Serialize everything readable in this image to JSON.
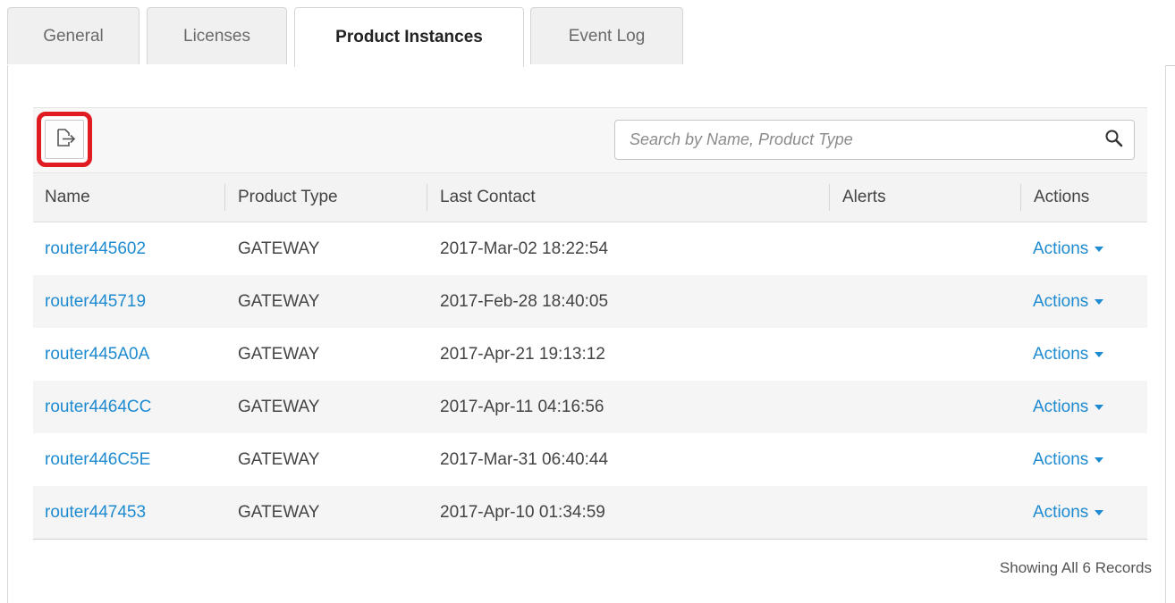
{
  "tabs": [
    {
      "label": "General",
      "active": false
    },
    {
      "label": "Licenses",
      "active": false
    },
    {
      "label": "Product Instances",
      "active": true
    },
    {
      "label": "Event Log",
      "active": false
    }
  ],
  "toolbar": {
    "export_icon": "export-icon",
    "search_placeholder": "Search by Name, Product Type",
    "search_value": "",
    "search_icon": "search-icon"
  },
  "table": {
    "columns": [
      "Name",
      "Product Type",
      "Last Contact",
      "Alerts",
      "Actions"
    ],
    "rows": [
      {
        "name": "router445602",
        "type": "GATEWAY",
        "last_contact": "2017-Mar-02 18:22:54",
        "alerts": "",
        "actions": "Actions"
      },
      {
        "name": "router445719",
        "type": "GATEWAY",
        "last_contact": "2017-Feb-28 18:40:05",
        "alerts": "",
        "actions": "Actions"
      },
      {
        "name": "router445A0A",
        "type": "GATEWAY",
        "last_contact": "2017-Apr-21 19:13:12",
        "alerts": "",
        "actions": "Actions"
      },
      {
        "name": "router4464CC",
        "type": "GATEWAY",
        "last_contact": "2017-Apr-11 04:16:56",
        "alerts": "",
        "actions": "Actions"
      },
      {
        "name": "router446C5E",
        "type": "GATEWAY",
        "last_contact": "2017-Mar-31 06:40:44",
        "alerts": "",
        "actions": "Actions"
      },
      {
        "name": "router447453",
        "type": "GATEWAY",
        "last_contact": "2017-Apr-10 01:34:59",
        "alerts": "",
        "actions": "Actions"
      }
    ]
  },
  "footer": {
    "records_text": "Showing All 6 Records"
  },
  "colors": {
    "link": "#1e8ad0",
    "highlight": "#e01b22"
  }
}
